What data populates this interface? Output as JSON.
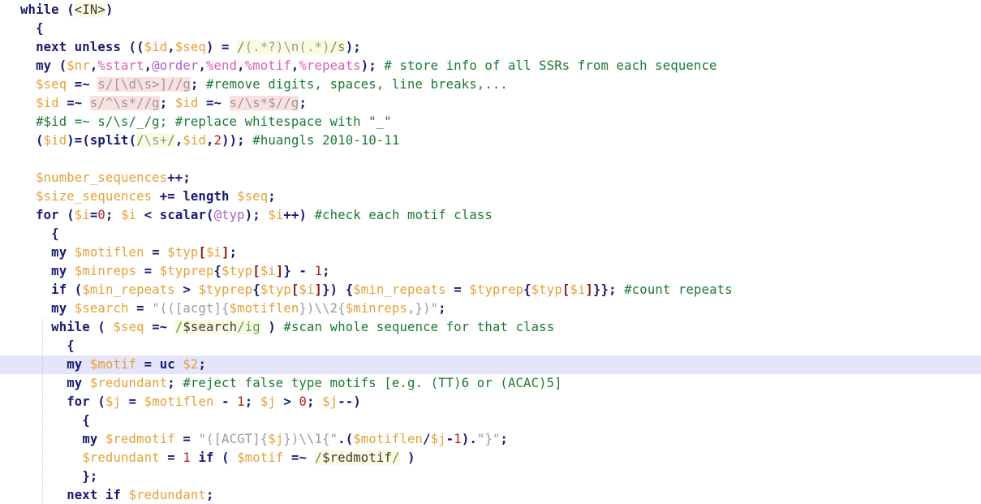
{
  "editor": {
    "language": "Perl",
    "current_line_number": 20,
    "background_color": "#ffffff",
    "current_line_highlight_color": "#e4e4fa",
    "indent_guide_color": "#c9c9d6"
  },
  "theme": {
    "keyword": "#191970",
    "scalar_variable": "#e5a138",
    "array_variable": "#b05fd0",
    "hash_variable": "#e060b0",
    "comment": "#1a7a32",
    "string": "#9a9aa0",
    "number": "#b22222",
    "bracket": "#8b1a1a",
    "regex_match_background": "#fbfbe0",
    "regex_substitution_background": "#fbe0e0"
  },
  "code": {
    "lines": [
      {
        "n": 1,
        "text": "while (<IN>)"
      },
      {
        "n": 2,
        "text": "  {"
      },
      {
        "n": 3,
        "text": "  next unless (($id,$seq) = /(.*?)\\n(.*)/s);"
      },
      {
        "n": 4,
        "text": "  my ($nr,%start,@order,%end,%motif,%repeats); # store info of all SSRs from each sequence"
      },
      {
        "n": 5,
        "text": "  $seq =~ s/[\\d\\s>]//g; #remove digits, spaces, line breaks,..."
      },
      {
        "n": 6,
        "text": "  $id =~ s/^\\s*//g; $id =~ s/\\s*$//g;"
      },
      {
        "n": 7,
        "text": "  #$id =~ s/\\s/_/g; #replace whitespace with \"_\""
      },
      {
        "n": 8,
        "text": "  ($id)=(split(/\\s+/,$id,2)); #huangls 2010-10-11"
      },
      {
        "n": 9,
        "text": ""
      },
      {
        "n": 10,
        "text": "  $number_sequences++;"
      },
      {
        "n": 11,
        "text": "  $size_sequences += length $seq;"
      },
      {
        "n": 12,
        "text": "  for ($i=0; $i < scalar(@typ); $i++) #check each motif class"
      },
      {
        "n": 13,
        "text": "    {"
      },
      {
        "n": 14,
        "text": "    my $motiflen = $typ[$i];"
      },
      {
        "n": 15,
        "text": "    my $minreps = $typrep{$typ[$i]} - 1;"
      },
      {
        "n": 16,
        "text": "    if ($min_repeats > $typrep{$typ[$i]}) {$min_repeats = $typrep{$typ[$i]}}; #count repeats"
      },
      {
        "n": 17,
        "text": "    my $search = \"(([acgt]{$motiflen})\\\\2{$minreps,})\";"
      },
      {
        "n": 18,
        "text": "    while ( $seq =~ /$search/ig ) #scan whole sequence for that class"
      },
      {
        "n": 19,
        "text": "      {"
      },
      {
        "n": 20,
        "text": "      my $motif = uc $2;"
      },
      {
        "n": 21,
        "text": "      my $redundant; #reject false type motifs [e.g. (TT)6 or (ACAC)5]"
      },
      {
        "n": 22,
        "text": "      for ($j = $motiflen - 1; $j > 0; $j--)"
      },
      {
        "n": 23,
        "text": "        {"
      },
      {
        "n": 24,
        "text": "        my $redmotif = \"([ACGT]{$j})\\\\1{\".($motiflen/$j-1).\"}\";"
      },
      {
        "n": 25,
        "text": "        $redundant = 1 if ( $motif =~ /$redmotif/ )"
      },
      {
        "n": 26,
        "text": "        };"
      },
      {
        "n": 27,
        "text": "      next if $redundant;"
      }
    ],
    "comments": [
      "# store info of all SSRs from each sequence",
      "#remove digits, spaces, line breaks,...",
      "#replace whitespace with \"_\"",
      "#huangls 2010-10-11",
      "#check each motif class",
      "#count repeats",
      "#scan whole sequence for that class",
      "#reject false type motifs [e.g. (TT)6 or (ACAC)5]"
    ],
    "keywords_used": [
      "while",
      "next",
      "unless",
      "my",
      "for",
      "if",
      "scalar",
      "split",
      "length",
      "uc"
    ],
    "variables": {
      "scalars": [
        "$id",
        "$seq",
        "$nr",
        "$number_sequences",
        "$size_sequences",
        "$i",
        "$motiflen",
        "$minreps",
        "$min_repeats",
        "$search",
        "$motif",
        "$redundant",
        "$j",
        "$redmotif",
        "$2"
      ],
      "arrays": [
        "@order",
        "@typ"
      ],
      "hashes": [
        "%start",
        "%end",
        "%motif",
        "%repeats",
        "$typrep"
      ]
    }
  }
}
